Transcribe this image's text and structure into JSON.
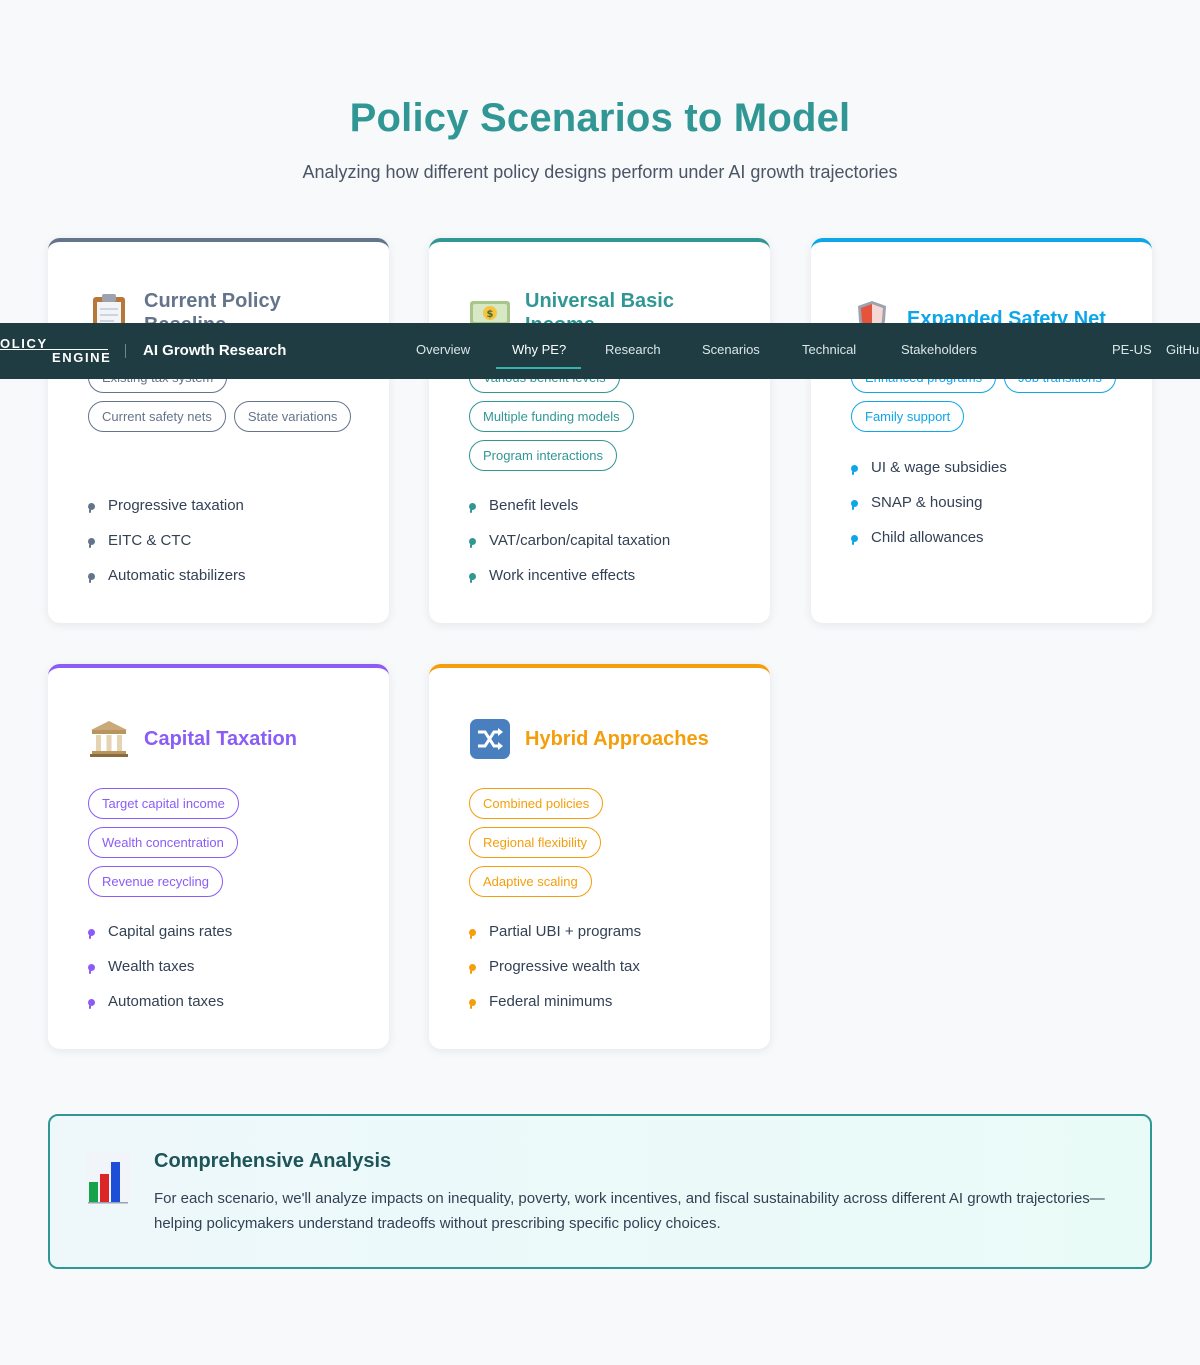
{
  "hero": {
    "title": "Policy Scenarios to Model",
    "subtitle": "Analyzing how different policy designs perform under AI growth trajectories"
  },
  "nav": {
    "logo_line1": "OLICY",
    "logo_line2": "ENGINE",
    "brand": "AI Growth Research",
    "links": [
      "Overview",
      "Why PE?",
      "Research",
      "Scenarios",
      "Technical",
      "Stakeholders"
    ],
    "active": "Why PE?",
    "right_links": [
      "PE-US",
      "GitHu"
    ]
  },
  "cards": [
    {
      "title": "Current Policy Baseline",
      "icon": "clipboard-icon",
      "color": "#64748b",
      "tags": [
        "Existing tax system",
        "Current safety nets",
        "State variations"
      ],
      "bullets": [
        "Progressive taxation",
        "EITC & CTC",
        "Automatic stabilizers"
      ]
    },
    {
      "title": "Universal Basic Income",
      "icon": "money-icon",
      "color": "#319795",
      "tags": [
        "Various benefit levels",
        "Multiple funding models",
        "Program interactions"
      ],
      "bullets": [
        "Benefit levels",
        "VAT/carbon/capital taxation",
        "Work incentive effects"
      ]
    },
    {
      "title": "Expanded Safety Net",
      "icon": "shield-icon",
      "color": "#0ea5e9",
      "tags": [
        "Enhanced programs",
        "Job transitions",
        "Family support"
      ],
      "bullets": [
        "UI & wage subsidies",
        "SNAP & housing",
        "Child allowances"
      ]
    },
    {
      "title": "Capital Taxation",
      "icon": "bank-icon",
      "color": "#8b5cf6",
      "tags": [
        "Target capital income",
        "Wealth concentration",
        "Revenue recycling"
      ],
      "bullets": [
        "Capital gains rates",
        "Wealth taxes",
        "Automation taxes"
      ]
    },
    {
      "title": "Hybrid Approaches",
      "icon": "shuffle-icon",
      "color": "#f59e0b",
      "tags": [
        "Combined policies",
        "Regional flexibility",
        "Adaptive scaling"
      ],
      "bullets": [
        "Partial UBI + programs",
        "Progressive wealth tax",
        "Federal minimums"
      ]
    }
  ],
  "summary": {
    "icon": "bar-chart-icon",
    "title": "Comprehensive Analysis",
    "text": "For each scenario, we'll analyze impacts on inequality, poverty, work incentives, and fiscal sustainability across different AI growth trajectories—helping policymakers understand tradeoffs without prescribing specific policy choices."
  }
}
